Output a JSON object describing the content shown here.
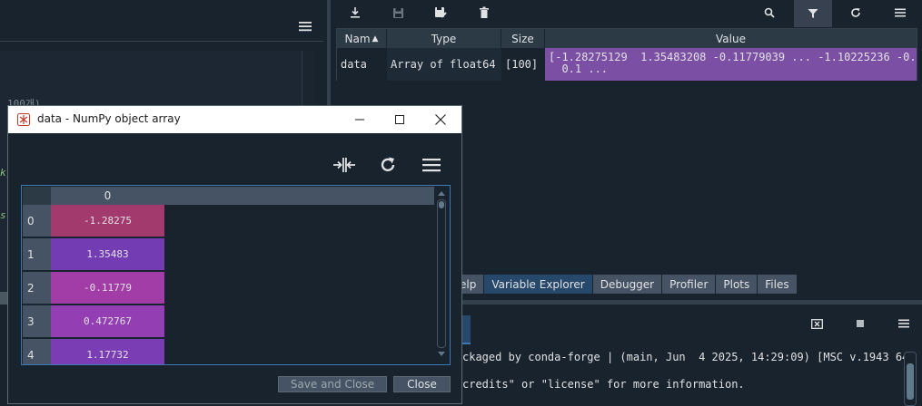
{
  "editor": {
    "frag_line1": "100개)",
    "frag_line2": "k)",
    "frag_line3": "s"
  },
  "variable_explorer": {
    "columns": [
      "Nam",
      "Type",
      "Size",
      "Value"
    ],
    "row": {
      "name": "data",
      "type": "Array of float64",
      "size": "[100]",
      "value": "[-1.28275129  1.35483208 -0.11779039 ... -1.10225236 -0....\n  0.1 ..."
    },
    "value_color": "#7b4fa3"
  },
  "pane_tabs": [
    {
      "label": "elp",
      "active": false
    },
    {
      "label": "Variable Explorer",
      "active": true
    },
    {
      "label": "Debugger",
      "active": false
    },
    {
      "label": "Profiler",
      "active": false
    },
    {
      "label": "Plots",
      "active": false
    },
    {
      "label": "Files",
      "active": false
    }
  ],
  "console": {
    "line1": "ckaged by conda-forge | (main, Jun  4 2025, 14:29:09) [MSC v.1943 64",
    "line2": "credits\" or \"license\" for more information."
  },
  "dialog": {
    "title": "data - NumPy object array",
    "column_header": "0",
    "rows": [
      {
        "index": "0",
        "value": "-1.28275",
        "color": "#a33a6e"
      },
      {
        "index": "1",
        "value": "1.35483",
        "color": "#733cb3"
      },
      {
        "index": "2",
        "value": "-0.11779",
        "color": "#a23ca6"
      },
      {
        "index": "3",
        "value": "0.472767",
        "color": "#933fb3"
      },
      {
        "index": "4",
        "value": "1.17732",
        "color": "#7a3db3"
      }
    ],
    "save_close_label": "Save and Close",
    "close_label": "Close"
  }
}
